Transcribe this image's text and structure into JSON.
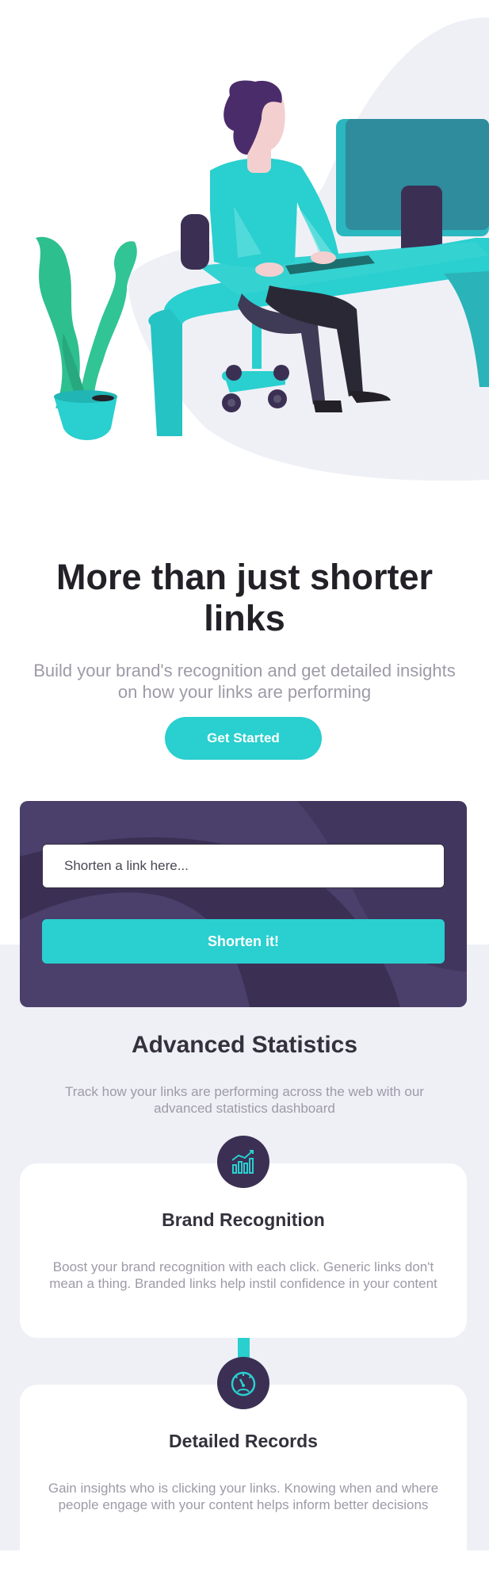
{
  "hero": {
    "title": "More than just shorter links",
    "subtitle": "Build your brand's recognition and get detailed insights on how your links are performing",
    "cta_label": "Get Started"
  },
  "shorten": {
    "placeholder": "Shorten a link here...",
    "button_label": "Shorten it!"
  },
  "statistics": {
    "title": "Advanced Statistics",
    "subtitle": "Track how your links are performing across the web with our advanced statistics dashboard",
    "cards": [
      {
        "icon": "brand-recognition-icon",
        "title": "Brand Recognition",
        "text": "Boost your brand recognition with each click. Generic links don't mean a thing. Branded links help instil confidence in your content"
      },
      {
        "icon": "detailed-records-icon",
        "title": "Detailed Records",
        "text": "Gain insights who is clicking your links. Knowing when and where people engage with your content helps inform better decisions"
      }
    ]
  },
  "colors": {
    "primary_cyan": "#2acfcf",
    "dark_violet": "#3b3054",
    "grayish_violet": "#9e9aa7",
    "very_dark_violet": "#232127",
    "light_gray": "#eff0f6"
  }
}
